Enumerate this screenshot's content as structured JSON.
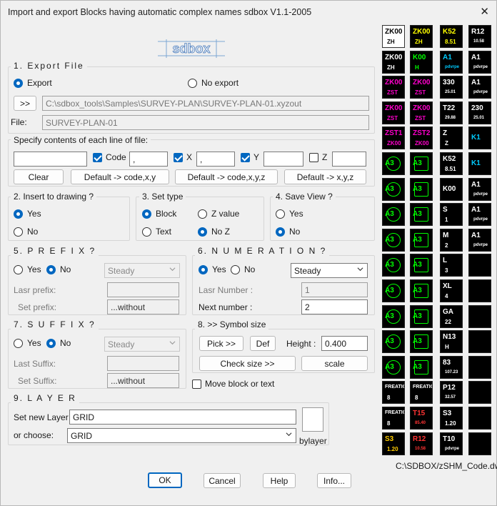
{
  "window": {
    "title": "Import and export Blocks having automatic complex names    sdbox  V1.1-2005"
  },
  "logo": {
    "text": "sdbox"
  },
  "export": {
    "title": "1. Export   File",
    "export_label": "Export",
    "noexport_label": "No export",
    "browse_label": ">>",
    "path_value": "C:\\sdbox_tools\\Samples\\SURVEY-PLAN\\SURVEY-PLAN-01.xyzout",
    "file_label": "File:",
    "file_value": "SURVEY-PLAN-01"
  },
  "contents": {
    "title": "Specify contents of each line of file:",
    "field1": "",
    "code_label": "Code",
    "sep1": ",",
    "x_label": "X",
    "sep2": ",",
    "y_label": "Y",
    "field_y": "",
    "z_label": "Z",
    "field_z": "",
    "clear_label": "Clear",
    "default1": "Default -> code,x,y",
    "default2": "Default -> code,x,y,z",
    "default3": "Default -> x,y,z"
  },
  "insert": {
    "title": "2.  Insert to drawing ?",
    "yes": "Yes",
    "no": "No"
  },
  "settype": {
    "title": "3.  Set type",
    "block": "Block",
    "zvalue": "Z value",
    "text": "Text",
    "noz": "No Z"
  },
  "saveview": {
    "title": "4.  Save View ?",
    "yes": "Yes",
    "no": "No"
  },
  "prefix": {
    "title": "5. P R E F I X ?",
    "yes": "Yes",
    "no": "No",
    "select": "Steady",
    "last_label": "Lasr prefix:",
    "last_value": "",
    "set_label": "Set prefix:",
    "set_value": "...without"
  },
  "numeration": {
    "title": "6.  N U M E R A T I O N ?",
    "yes": "Yes",
    "no": "No",
    "select": "Steady",
    "last_label": "Lasr Number :",
    "last_value": "1",
    "next_label": "Next number :",
    "next_value": "2"
  },
  "suffix": {
    "title": "7.  S U F F I X ?",
    "yes": "Yes",
    "no": "No",
    "select": "Steady",
    "last_label": "Last Suffix:",
    "last_value": "",
    "set_label": "Set Suffix:",
    "set_value": "...without"
  },
  "symbol": {
    "title": "8. >> Symbol size",
    "pick_label": "Pick >>",
    "def_label": "Def",
    "height_label": "Height :",
    "height_value": "0.400",
    "check_label": "Check size >>",
    "scale_label": "scale"
  },
  "move_label": "Move block or text",
  "layer": {
    "title": "9.  L A Y E R",
    "set_label": "Set new Layer :",
    "set_value": "GRID",
    "choose_label": "or choose:",
    "choose_value": "GRID",
    "bylayer_label": "bylayer"
  },
  "buttons": {
    "ok": "OK",
    "cancel": "Cancel",
    "help": "Help",
    "info": "Info..."
  },
  "preview_path": "C:\\SDBOX/zSHM_Code.dwg",
  "blocks": [
    {
      "t1": "ZK00",
      "t2": "ZH",
      "c": "#000000"
    },
    {
      "t1": "ZK00",
      "t2": "ZH",
      "c": "#ffff00"
    },
    {
      "t1": "K52",
      "t2": "8.51",
      "c": "#ffff00"
    },
    {
      "t1": "R12",
      "t2": "10.58",
      "c": "#ffffff"
    },
    {
      "t1": "ZK00",
      "t2": "ZH",
      "c": "#ffffff"
    },
    {
      "t1": "K00",
      "t2": "H",
      "c": "#00ff00"
    },
    {
      "t1": "A1",
      "t2": "pdvrpe",
      "c": "#00ccff"
    },
    {
      "t1": "A1",
      "t2": "pdvrpe",
      "c": "#ffffff"
    },
    {
      "t1": "ZK00",
      "t2": "ZST",
      "c": "#ff00cc"
    },
    {
      "t1": "ZK00",
      "t2": "ZST",
      "c": "#ff00cc"
    },
    {
      "t1": "330",
      "t2": "25.01",
      "c": "#ffffff"
    },
    {
      "t1": "A1",
      "t2": "pdvrpe",
      "c": "#ffffff"
    },
    {
      "t1": "ZK00",
      "t2": "ZST",
      "c": "#ff00cc"
    },
    {
      "t1": "ZK00",
      "t2": "ZST",
      "c": "#ff00cc"
    },
    {
      "t1": "T22",
      "t2": "29.88",
      "c": "#ffffff"
    },
    {
      "t1": "230",
      "t2": "25.01",
      "c": "#ffffff"
    },
    {
      "t1": "ZST1",
      "t2": "ZK00",
      "c": "#ff00cc"
    },
    {
      "t1": "ZST2",
      "t2": "ZK00",
      "c": "#ff00cc"
    },
    {
      "t1": "Z",
      "t2": "Z",
      "c": "#ffffff"
    },
    {
      "t1": "K1",
      "t2": "",
      "c": "#00ccff"
    },
    {
      "t1": "A3",
      "t2": "",
      "c": "#00ff00"
    },
    {
      "t1": "A3",
      "t2": "",
      "c": "#00ff00"
    },
    {
      "t1": "K52",
      "t2": "8.51",
      "c": "#ffffff"
    },
    {
      "t1": "K1",
      "t2": "",
      "c": "#00ccff"
    },
    {
      "t1": "A3",
      "t2": "",
      "c": "#00ff00"
    },
    {
      "t1": "A3",
      "t2": "",
      "c": "#00ff00"
    },
    {
      "t1": "K00",
      "t2": "",
      "c": "#ffffff"
    },
    {
      "t1": "A1",
      "t2": "pdvrpe",
      "c": "#ffffff"
    },
    {
      "t1": "A3",
      "t2": "",
      "c": "#00ff00"
    },
    {
      "t1": "A3",
      "t2": "",
      "c": "#00ff00"
    },
    {
      "t1": "S",
      "t2": "1",
      "c": "#ffffff"
    },
    {
      "t1": "A1",
      "t2": "pdvrpe",
      "c": "#ffffff"
    },
    {
      "t1": "A3",
      "t2": "",
      "c": "#00ff00"
    },
    {
      "t1": "A3",
      "t2": "",
      "c": "#00ff00"
    },
    {
      "t1": "M",
      "t2": "2",
      "c": "#ffffff"
    },
    {
      "t1": "A1",
      "t2": "pdvrpe",
      "c": "#ffffff"
    },
    {
      "t1": "A3",
      "t2": "",
      "c": "#00ff00"
    },
    {
      "t1": "A3",
      "t2": "",
      "c": "#00ff00"
    },
    {
      "t1": "L",
      "t2": "3",
      "c": "#ffffff"
    },
    {
      "t1": "",
      "t2": "",
      "c": "#000000"
    },
    {
      "t1": "A3",
      "t2": "",
      "c": "#00ff00"
    },
    {
      "t1": "A3",
      "t2": "",
      "c": "#00ff00"
    },
    {
      "t1": "XL",
      "t2": "4",
      "c": "#ffffff"
    },
    {
      "t1": "",
      "t2": "",
      "c": "#000000"
    },
    {
      "t1": "A3",
      "t2": "",
      "c": "#00ff00"
    },
    {
      "t1": "A3",
      "t2": "",
      "c": "#00ff00"
    },
    {
      "t1": "GA",
      "t2": "22",
      "c": "#ffffff"
    },
    {
      "t1": "",
      "t2": "",
      "c": "#000000"
    },
    {
      "t1": "A3",
      "t2": "",
      "c": "#00ff00"
    },
    {
      "t1": "A3",
      "t2": "",
      "c": "#00ff00"
    },
    {
      "t1": "N13",
      "t2": "H",
      "c": "#ffffff"
    },
    {
      "t1": "",
      "t2": "",
      "c": "#000000"
    },
    {
      "t1": "A3",
      "t2": "",
      "c": "#00ff00"
    },
    {
      "t1": "A3",
      "t2": "",
      "c": "#00ff00"
    },
    {
      "t1": "83",
      "t2": "107.23",
      "c": "#ffffff"
    },
    {
      "t1": "",
      "t2": "",
      "c": "#000000"
    },
    {
      "t1": "FREATIO",
      "t2": "8",
      "c": "#ffffff"
    },
    {
      "t1": "FREATIO",
      "t2": "8",
      "c": "#ffffff"
    },
    {
      "t1": "P12",
      "t2": "32.57",
      "c": "#ffffff"
    },
    {
      "t1": "",
      "t2": "",
      "c": "#000000"
    },
    {
      "t1": "FREATIO",
      "t2": "8",
      "c": "#ffffff"
    },
    {
      "t1": "T15",
      "t2": "85.40",
      "c": "#ff3333"
    },
    {
      "t1": "S3",
      "t2": "1.20",
      "c": "#ffffff"
    },
    {
      "t1": "",
      "t2": "",
      "c": "#000000"
    },
    {
      "t1": "S3",
      "t2": "1.20",
      "c": "#ffcc00"
    },
    {
      "t1": "R12",
      "t2": "10.58",
      "c": "#ff3333"
    },
    {
      "t1": "T10",
      "t2": "pdvrpe",
      "c": "#ffffff"
    },
    {
      "t1": "",
      "t2": "",
      "c": "#000000"
    }
  ]
}
